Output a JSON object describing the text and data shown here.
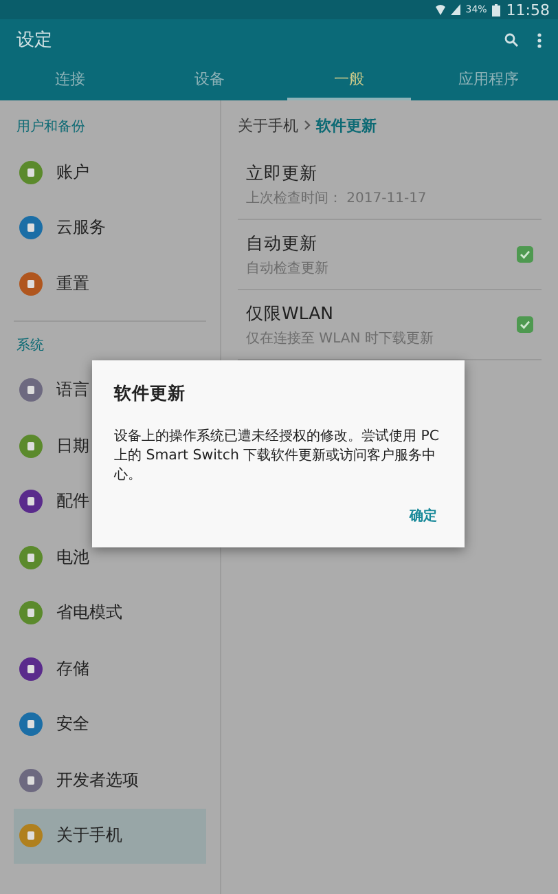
{
  "status_bar": {
    "battery": "34%",
    "time": "11:58"
  },
  "app_bar": {
    "title": "设定"
  },
  "tabs": [
    {
      "label": "连接",
      "selected": false
    },
    {
      "label": "设备",
      "selected": false
    },
    {
      "label": "一般",
      "selected": true
    },
    {
      "label": "应用程序",
      "selected": false
    }
  ],
  "sidebar": {
    "sections": [
      {
        "title": "用户和备份",
        "items": [
          {
            "label": "账户",
            "color": "#5b8a2c",
            "selected": false
          },
          {
            "label": "云服务",
            "color": "#1b6ea6",
            "selected": false
          },
          {
            "label": "重置",
            "color": "#b0561e",
            "selected": false
          }
        ]
      },
      {
        "title": "系统",
        "items": [
          {
            "label": "语言",
            "color": "#6d6980",
            "selected": false
          },
          {
            "label": "日期",
            "color": "#5b8a2c",
            "selected": false
          },
          {
            "label": "配件",
            "color": "#5a2b8c",
            "selected": false
          },
          {
            "label": "电池",
            "color": "#5b8a2c",
            "selected": false
          },
          {
            "label": "省电模式",
            "color": "#5b8a2c",
            "selected": false
          },
          {
            "label": "存储",
            "color": "#5a2b8c",
            "selected": false
          },
          {
            "label": "安全",
            "color": "#1b6ea6",
            "selected": false
          },
          {
            "label": "开发者选项",
            "color": "#6d6980",
            "selected": false
          },
          {
            "label": "关于手机",
            "color": "#b0801e",
            "selected": true
          }
        ]
      }
    ]
  },
  "breadcrumb": {
    "parent": "关于手机",
    "current": "软件更新"
  },
  "settings": [
    {
      "title": "立即更新",
      "subtitle": "上次检查时间： 2017-11-17",
      "kind": "plain"
    },
    {
      "title": "自动更新",
      "subtitle": "自动检查更新",
      "kind": "checkbox",
      "checked": true
    },
    {
      "title": "仅限WLAN",
      "subtitle": "仅在连接至 WLAN 时下载更新",
      "kind": "checkbox",
      "checked": true
    }
  ],
  "dialog": {
    "title": "软件更新",
    "message": "设备上的操作系统已遭未经授权的修改。尝试使用 PC 上的 Smart Switch 下载软件更新或访问客户服务中心。",
    "button": "确定"
  }
}
